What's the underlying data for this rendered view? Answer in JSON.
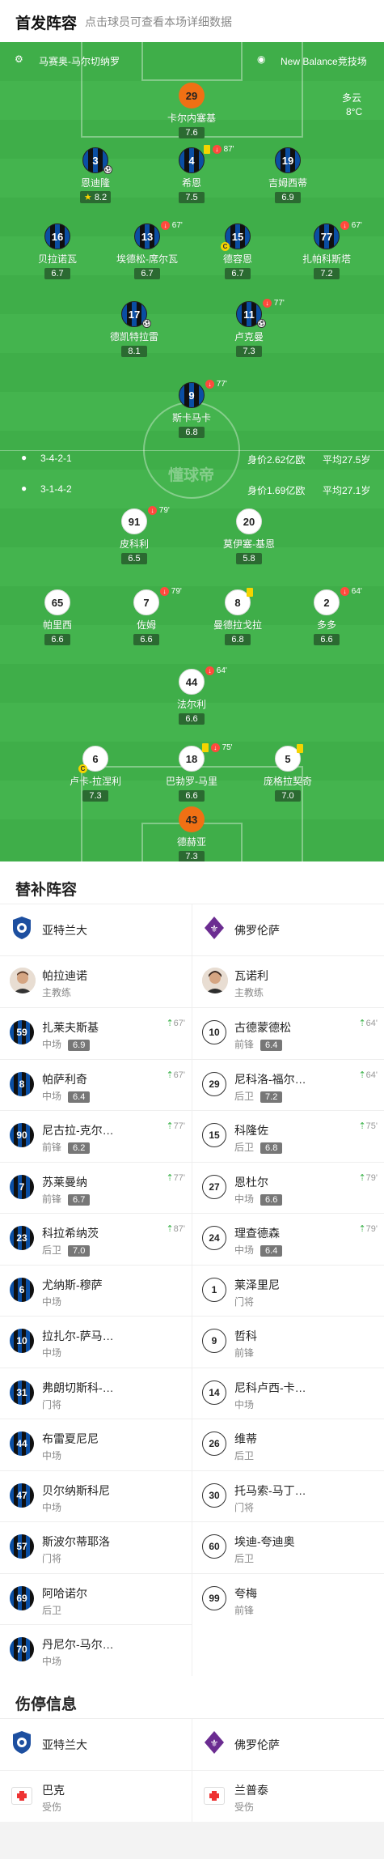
{
  "header": {
    "title": "首发阵容",
    "subtitle": "点击球员可查看本场详细数据"
  },
  "pitch": {
    "coach_home": "马赛奥-马尔切纳罗",
    "brand": "New Balance竞技场",
    "weather": "多云",
    "temp": "8°C",
    "watermark": "懂球帝",
    "home_formation": "3-4-2-1",
    "home_value": "身价2.62亿欧",
    "home_age": "平均27.5岁",
    "away_formation": "3-1-4-2",
    "away_value": "身价1.69亿欧",
    "away_age": "平均27.1岁"
  },
  "home_players": [
    {
      "num": "29",
      "name": "卡尔内塞基",
      "rating": "7.6",
      "gk": true
    },
    {
      "num": "3",
      "name": "恩迪隆",
      "rating": "8.2",
      "star": "★"
    },
    {
      "num": "4",
      "name": "希恩",
      "rating": "7.5",
      "time": "87'"
    },
    {
      "num": "19",
      "name": "吉姆西蒂",
      "rating": "6.9"
    },
    {
      "num": "16",
      "name": "贝拉诺瓦",
      "rating": "6.7"
    },
    {
      "num": "13",
      "name": "埃德松-席尔瓦",
      "rating": "6.7",
      "time": "67'"
    },
    {
      "num": "15",
      "name": "德容恩",
      "rating": "6.7",
      "cap": "C"
    },
    {
      "num": "77",
      "name": "扎帕科斯塔",
      "rating": "7.2",
      "time": "67'"
    },
    {
      "num": "17",
      "name": "德凯特拉雷",
      "rating": "8.1"
    },
    {
      "num": "11",
      "name": "卢克曼",
      "rating": "7.3",
      "time": "77'"
    },
    {
      "num": "9",
      "name": "斯卡马卡",
      "rating": "6.8",
      "time": "77'"
    }
  ],
  "away_players": [
    {
      "num": "91",
      "name": "皮科利",
      "rating": "6.5",
      "time": "79'"
    },
    {
      "num": "20",
      "name": "莫伊塞-基恩",
      "rating": "5.8"
    },
    {
      "num": "65",
      "name": "帕里西",
      "rating": "6.6"
    },
    {
      "num": "7",
      "name": "佐姆",
      "rating": "6.6",
      "time": "79'"
    },
    {
      "num": "8",
      "name": "曼德拉戈拉",
      "rating": "6.8"
    },
    {
      "num": "2",
      "name": "多多",
      "rating": "6.6",
      "time": "64'"
    },
    {
      "num": "44",
      "name": "法尔利",
      "rating": "6.6",
      "time": "64'"
    },
    {
      "num": "6",
      "name": "卢卡-拉涅利",
      "rating": "7.3",
      "cap": "C"
    },
    {
      "num": "18",
      "name": "巴勃罗-马里",
      "rating": "6.6",
      "time": "75'"
    },
    {
      "num": "5",
      "name": "庞格拉契奇",
      "rating": "7.0"
    },
    {
      "num": "43",
      "name": "德赫亚",
      "rating": "7.3",
      "gk": true
    }
  ],
  "subs": {
    "title": "替补阵容",
    "home_team": "亚特兰大",
    "away_team": "佛罗伦萨",
    "home_coach": "帕拉迪诺",
    "away_coach": "瓦诺利",
    "coach_label": "主教练",
    "home": [
      {
        "num": "59",
        "name": "扎莱夫斯基",
        "pos": "中场",
        "rating": "6.9",
        "time": "67'"
      },
      {
        "num": "8",
        "name": "帕萨利奇",
        "pos": "中场",
        "rating": "6.4",
        "time": "67'"
      },
      {
        "num": "90",
        "name": "尼古拉-克尔…",
        "pos": "前锋",
        "rating": "6.2",
        "time": "77'"
      },
      {
        "num": "7",
        "name": "苏莱曼纳",
        "pos": "前锋",
        "rating": "6.7",
        "time": "77'"
      },
      {
        "num": "23",
        "name": "科拉希纳茨",
        "pos": "后卫",
        "rating": "7.0",
        "time": "87'"
      },
      {
        "num": "6",
        "name": "尤纳斯-穆萨",
        "pos": "中场"
      },
      {
        "num": "10",
        "name": "拉扎尔-萨马…",
        "pos": "中场"
      },
      {
        "num": "31",
        "name": "弗朗切斯科-…",
        "pos": "门将"
      },
      {
        "num": "44",
        "name": "布雷夏尼尼",
        "pos": "中场"
      },
      {
        "num": "47",
        "name": "贝尔纳斯科尼",
        "pos": "中场"
      },
      {
        "num": "57",
        "name": "斯波尔蒂耶洛",
        "pos": "门将"
      },
      {
        "num": "69",
        "name": "阿哈诺尔",
        "pos": "后卫"
      },
      {
        "num": "70",
        "name": "丹尼尔-马尔…",
        "pos": "中场"
      }
    ],
    "away": [
      {
        "num": "10",
        "name": "古德蒙德松",
        "pos": "前锋",
        "rating": "6.4",
        "time": "64'"
      },
      {
        "num": "29",
        "name": "尼科洛-福尔…",
        "pos": "后卫",
        "rating": "7.2",
        "time": "64'"
      },
      {
        "num": "15",
        "name": "科隆佐",
        "pos": "后卫",
        "rating": "6.8",
        "time": "75'"
      },
      {
        "num": "27",
        "name": "恩杜尔",
        "pos": "中场",
        "rating": "6.6",
        "time": "79'"
      },
      {
        "num": "24",
        "name": "理查德森",
        "pos": "中场",
        "rating": "6.4",
        "time": "79'"
      },
      {
        "num": "1",
        "name": "莱泽里尼",
        "pos": "门将"
      },
      {
        "num": "9",
        "name": "哲科",
        "pos": "前锋"
      },
      {
        "num": "14",
        "name": "尼科卢西-卡…",
        "pos": "中场"
      },
      {
        "num": "26",
        "name": "维蒂",
        "pos": "后卫"
      },
      {
        "num": "30",
        "name": "托马索-马丁…",
        "pos": "门将"
      },
      {
        "num": "60",
        "name": "埃迪-夸迪奥",
        "pos": "后卫"
      },
      {
        "num": "99",
        "name": "夸梅",
        "pos": "前锋"
      }
    ]
  },
  "injuries": {
    "title": "伤停信息",
    "home_team": "亚特兰大",
    "away_team": "佛罗伦萨",
    "home": [
      {
        "name": "巴克",
        "status": "受伤"
      }
    ],
    "away": [
      {
        "name": "兰普泰",
        "status": "受伤"
      }
    ]
  },
  "colors": {
    "pitch": "#3fae49",
    "gk": "#f07014",
    "sub_in": "#3bb34a",
    "sub_off": "#ff4a3d"
  }
}
